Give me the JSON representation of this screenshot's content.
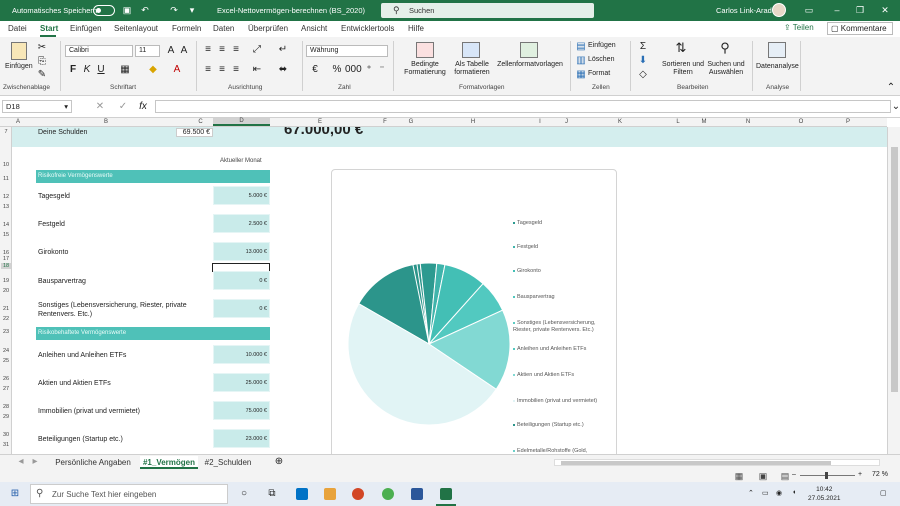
{
  "titlebar": {
    "autosave_label": "Automatisches Speichern",
    "doc_title": "Excel-Nettovermögen-berechnen (BS_2020)",
    "search_placeholder": "Suchen",
    "user_name": "Carlos Link-Arad"
  },
  "tabs": [
    "Datei",
    "Start",
    "Einfügen",
    "Seitenlayout",
    "Formeln",
    "Daten",
    "Überprüfen",
    "Ansicht",
    "Entwicklertools",
    "Hilfe"
  ],
  "share_label": "Teilen",
  "comment_label": "Kommentare",
  "ribbon": {
    "paste_label": "Einfügen",
    "clipboard_group": "Zwischenablage",
    "font_name": "Calibri",
    "font_size": "11",
    "bold": "F",
    "italic": "K",
    "underline": "U",
    "font_group": "Schriftart",
    "alignment_group": "Ausrichtung",
    "number_format": "Währung",
    "number_group": "Zahl",
    "cond_format": "Bedingte Formatierung",
    "format_table": "Als Tabelle formatieren",
    "cell_styles": "Zellenformatvorlagen",
    "styles_group": "Formatvorlagen",
    "cells_insert": "Einfügen",
    "cells_delete": "Löschen",
    "cells_format": "Format",
    "cells_group": "Zellen",
    "sort_filter": "Sortieren und Filtern",
    "find_select": "Suchen und Auswählen",
    "edit_group": "Bearbeiten",
    "data_analysis": "Datenanalyse",
    "analysis_group": "Analyse"
  },
  "formula_bar": {
    "namebox": "D18",
    "fx": "fx",
    "value": ""
  },
  "columns": [
    "A",
    "B",
    "C",
    "D",
    "E",
    "F",
    "G",
    "H",
    "I",
    "J",
    "K",
    "L",
    "M",
    "N",
    "O",
    "P"
  ],
  "rows": [
    "7",
    "",
    "10",
    "11",
    "12",
    "13",
    "14",
    "15",
    "16",
    "17",
    "18",
    "19",
    "20",
    "21",
    "22",
    "23",
    "24",
    "25",
    "26",
    "27",
    "28",
    "29",
    "30",
    "31",
    "32"
  ],
  "sheet": {
    "schulden_label": "Deine Schulden",
    "schulden_value": "69.500 €",
    "total": "67.000,00 €",
    "monat_header": "Aktueller Monat",
    "section_risk_free": "Risikofreie Vermögenswerte",
    "section_risky": "Risikobehaftete Vermögenswerte",
    "items": [
      {
        "label": "Tagesgeld",
        "value": "5.000 €"
      },
      {
        "label": "Festgeld",
        "value": "2.500 €"
      },
      {
        "label": "Girokonto",
        "value": "13.000 €"
      },
      {
        "label": "Bausparvertrag",
        "value": "0 €"
      },
      {
        "label": "Sonstiges (Lebensversicherung, Riester, private Rentenvers. Etc.)",
        "value": "0 €"
      },
      {
        "label": "Anleihen und Anleihen ETFs",
        "value": "10.000 €"
      },
      {
        "label": "Aktien und Aktien ETFs",
        "value": "25.000 €"
      },
      {
        "label": "Immobilien (privat und vermietet)",
        "value": "75.000 €"
      },
      {
        "label": "Beteiligungen (Startup etc.)",
        "value": "23.000 €"
      }
    ]
  },
  "chart_data": {
    "type": "pie",
    "categories": [
      "Tagesgeld",
      "Festgeld",
      "Girokonto",
      "Bausparvertrag",
      "Sonstiges (Lebensversicherung, Riester, private Rentenvers. Etc.)",
      "Anleihen und Anleihen ETFs",
      "Aktien und Aktien ETFs",
      "Immobilien (privat und vermietet)",
      "Beteiligungen (Startup etc.)",
      "Edelmetalle/Rohstoffe (Gold,"
    ],
    "values": [
      5000,
      2500,
      13000,
      0,
      0,
      10000,
      25000,
      75000,
      23000,
      0
    ],
    "colors": [
      "#2d9a90",
      "#3fb4ab",
      "#43bfb5",
      "#4fc7bd",
      "#5ccbc2",
      "#52c9c0",
      "#82d9d3",
      "#e1f4f5",
      "#2c958b",
      "#6ccfc8"
    ]
  },
  "sheet_tabs": [
    "Persönliche Angaben",
    "#1_Vermögen",
    "#2_Schulden"
  ],
  "status": {
    "zoom": "72 %"
  },
  "taskbar": {
    "search_placeholder": "Zur Suche Text hier eingeben",
    "time": "10:42",
    "date": "27.05.2021"
  }
}
